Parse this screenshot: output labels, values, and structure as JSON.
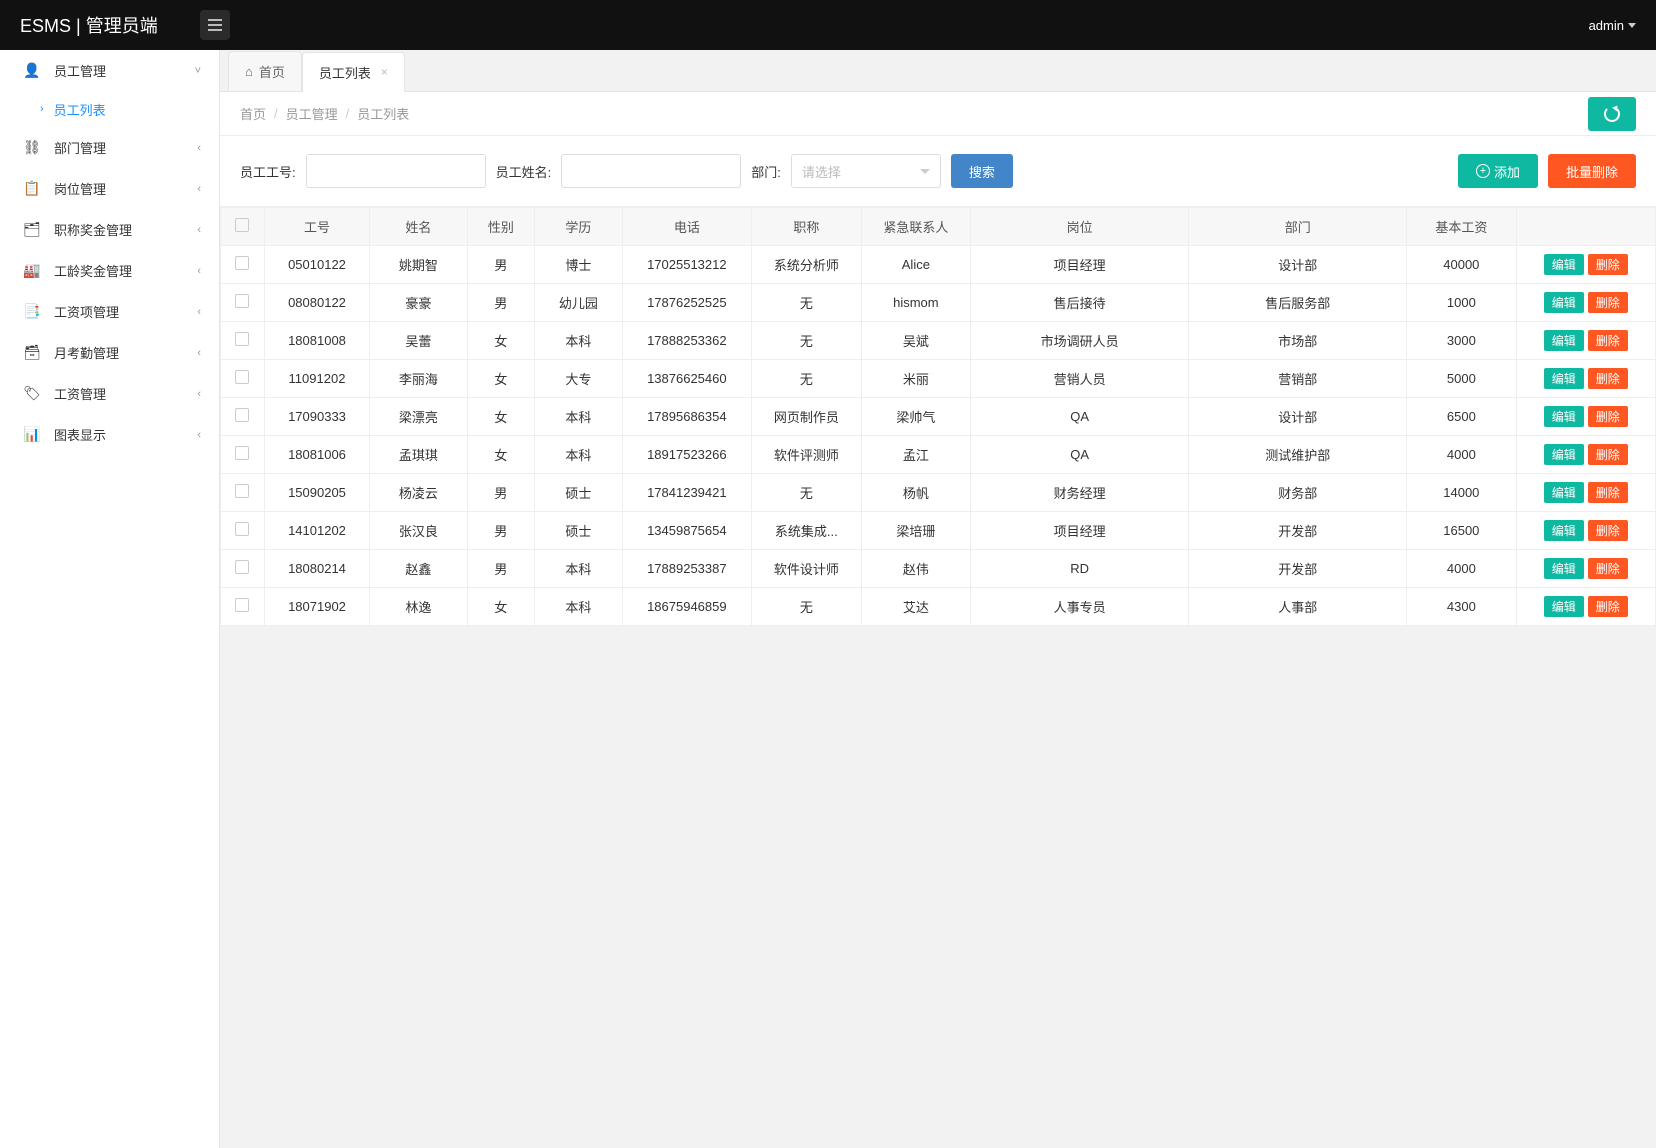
{
  "header": {
    "brand": "ESMS | 管理员端",
    "user": "admin"
  },
  "sidebar": {
    "active_sub": "员工列表",
    "items": [
      {
        "icon": "👤",
        "label": "员工管理",
        "open": true
      },
      {
        "icon": "⛓",
        "label": "部门管理"
      },
      {
        "icon": "📋",
        "label": "岗位管理"
      },
      {
        "icon": "🗂",
        "label": "职称奖金管理"
      },
      {
        "icon": "🏭",
        "label": "工龄奖金管理"
      },
      {
        "icon": "📑",
        "label": "工资项管理"
      },
      {
        "icon": "🗃",
        "label": "月考勤管理"
      },
      {
        "icon": "🏷",
        "label": "工资管理"
      },
      {
        "icon": "📊",
        "label": "图表显示"
      }
    ]
  },
  "tabs": [
    {
      "label": "首页",
      "closeable": false
    },
    {
      "label": "员工列表",
      "closeable": true,
      "active": true
    }
  ],
  "breadcrumb": [
    "首页",
    "员工管理",
    "员工列表"
  ],
  "filter": {
    "id_label": "员工工号:",
    "name_label": "员工姓名:",
    "dept_label": "部门:",
    "dept_placeholder": "请选择",
    "search_label": "搜索",
    "add_label": "添加",
    "bulk_delete_label": "批量删除"
  },
  "table": {
    "headers": [
      "",
      "工号",
      "姓名",
      "性别",
      "学历",
      "电话",
      "职称",
      "紧急联系人",
      "岗位",
      "部门",
      "基本工资",
      ""
    ],
    "edit_label": "编辑",
    "delete_label": "删除",
    "rows": [
      {
        "id": "05010122",
        "name": "姚期智",
        "sex": "男",
        "edu": "博士",
        "phone": "17025513212",
        "title": "系统分析师",
        "contact": "Alice",
        "post": "项目经理",
        "dept": "设计部",
        "salary": "40000"
      },
      {
        "id": "08080122",
        "name": "豪豪",
        "sex": "男",
        "edu": "幼儿园",
        "phone": "17876252525",
        "title": "无",
        "contact": "hismom",
        "post": "售后接待",
        "dept": "售后服务部",
        "salary": "1000"
      },
      {
        "id": "18081008",
        "name": "吴蕾",
        "sex": "女",
        "edu": "本科",
        "phone": "17888253362",
        "title": "无",
        "contact": "吴斌",
        "post": "市场调研人员",
        "dept": "市场部",
        "salary": "3000"
      },
      {
        "id": "11091202",
        "name": "李丽海",
        "sex": "女",
        "edu": "大专",
        "phone": "13876625460",
        "title": "无",
        "contact": "米丽",
        "post": "营销人员",
        "dept": "营销部",
        "salary": "5000"
      },
      {
        "id": "17090333",
        "name": "梁漂亮",
        "sex": "女",
        "edu": "本科",
        "phone": "17895686354",
        "title": "网页制作员",
        "contact": "梁帅气",
        "post": "QA",
        "dept": "设计部",
        "salary": "6500"
      },
      {
        "id": "18081006",
        "name": "孟琪琪",
        "sex": "女",
        "edu": "本科",
        "phone": "18917523266",
        "title": "软件评测师",
        "contact": "孟江",
        "post": "QA",
        "dept": "测试维护部",
        "salary": "4000"
      },
      {
        "id": "15090205",
        "name": "杨凌云",
        "sex": "男",
        "edu": "硕士",
        "phone": "17841239421",
        "title": "无",
        "contact": "杨帆",
        "post": "财务经理",
        "dept": "财务部",
        "salary": "14000"
      },
      {
        "id": "14101202",
        "name": "张汉良",
        "sex": "男",
        "edu": "硕士",
        "phone": "13459875654",
        "title": "系统集成...",
        "contact": "梁培珊",
        "post": "项目经理",
        "dept": "开发部",
        "salary": "16500"
      },
      {
        "id": "18080214",
        "name": "赵鑫",
        "sex": "男",
        "edu": "本科",
        "phone": "17889253387",
        "title": "软件设计师",
        "contact": "赵伟",
        "post": "RD",
        "dept": "开发部",
        "salary": "4000"
      },
      {
        "id": "18071902",
        "name": "林逸",
        "sex": "女",
        "edu": "本科",
        "phone": "18675946859",
        "title": "无",
        "contact": "艾达",
        "post": "人事专员",
        "dept": "人事部",
        "salary": "4300"
      }
    ]
  }
}
